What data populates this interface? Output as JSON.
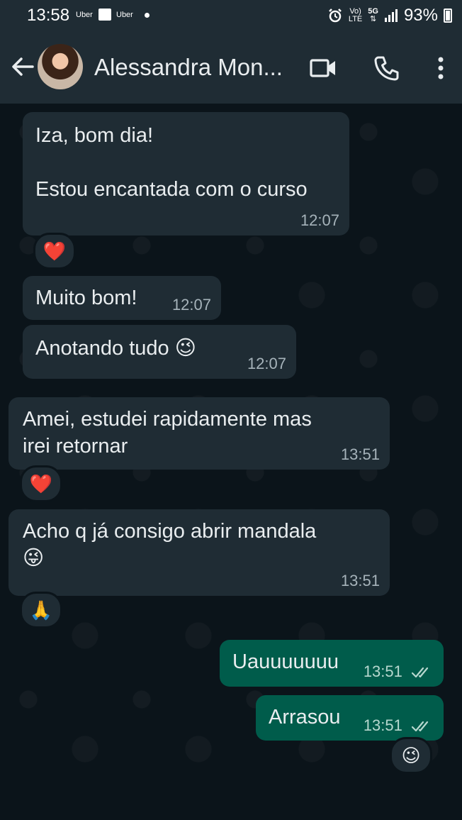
{
  "status_bar": {
    "time": "13:58",
    "app1": "Uber",
    "app2": "Uber",
    "network_top": "Vo)",
    "network_bottom": "LTE",
    "signal_type": "5G",
    "battery": "93%"
  },
  "header": {
    "contact_name": "Alessandra Mon..."
  },
  "messages": [
    {
      "direction": "in",
      "text": "Iza, bom dia!\n\nEstou encantada com o curso",
      "time": "12:07",
      "reaction": "❤️"
    },
    {
      "direction": "in",
      "text": "Muito bom!",
      "time": "12:07"
    },
    {
      "direction": "in",
      "text": "Anotando tudo 😉",
      "time": "12:07"
    },
    {
      "direction": "in",
      "text": "Amei, estudei rapidamente mas\nirei retornar",
      "time": "13:51",
      "reaction": "❤️"
    },
    {
      "direction": "in",
      "text": "Acho q já consigo abrir mandala\n😜",
      "time": "13:51",
      "reaction": "🙏"
    },
    {
      "direction": "out",
      "text": "Uauuuuuuu",
      "time": "13:51",
      "read": true
    },
    {
      "direction": "out",
      "text": "Arrasou",
      "time": "13:51",
      "read": true,
      "reaction": "😉"
    }
  ],
  "colors": {
    "background": "#0b141a",
    "header": "#1f2c34",
    "incoming_bubble": "#1f2c34",
    "outgoing_bubble": "#005c4b",
    "read_ticks": "#b7d8cf"
  }
}
